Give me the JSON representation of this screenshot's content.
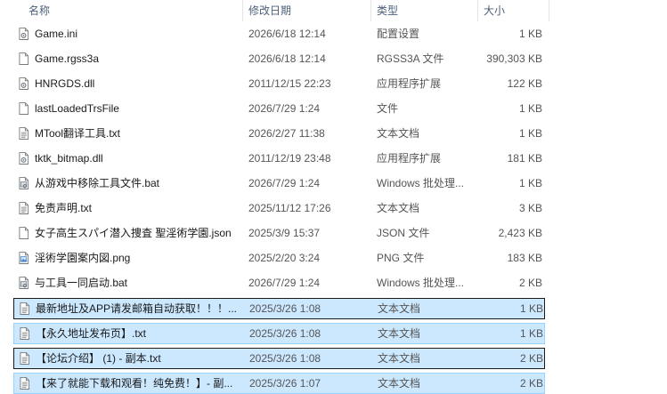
{
  "columns": {
    "name": "名称",
    "date": "修改日期",
    "type": "类型",
    "size": "大小"
  },
  "files": [
    {
      "name": "Game.ini",
      "date": "2026/6/18 12:14",
      "type": "配置设置",
      "size": "1 KB",
      "icon": "settings-file-icon"
    },
    {
      "name": "Game.rgss3a",
      "date": "2026/6/18 12:14",
      "type": "RGSS3A 文件",
      "size": "390,303 KB",
      "icon": "blank-file-icon"
    },
    {
      "name": "HNRGDS.dll",
      "date": "2011/12/15 22:23",
      "type": "应用程序扩展",
      "size": "122 KB",
      "icon": "dll-file-icon"
    },
    {
      "name": "lastLoadedTrsFile",
      "date": "2026/7/29 1:24",
      "type": "文件",
      "size": "1 KB",
      "icon": "blank-file-icon"
    },
    {
      "name": "MTool翻译工具.txt",
      "date": "2026/2/27 11:38",
      "type": "文本文档",
      "size": "1 KB",
      "icon": "text-file-icon"
    },
    {
      "name": "tktk_bitmap.dll",
      "date": "2011/12/19 23:48",
      "type": "应用程序扩展",
      "size": "181 KB",
      "icon": "dll-file-icon"
    },
    {
      "name": "从游戏中移除工具文件.bat",
      "date": "2026/7/29 1:24",
      "type": "Windows 批处理...",
      "size": "1 KB",
      "icon": "batch-file-icon"
    },
    {
      "name": "免责声明.txt",
      "date": "2025/11/12 17:26",
      "type": "文本文档",
      "size": "3 KB",
      "icon": "text-file-icon"
    },
    {
      "name": "女子高生スパイ潜入捜査 聖淫術学園.json",
      "date": "2025/3/9 15:37",
      "type": "JSON 文件",
      "size": "2,423 KB",
      "icon": "blank-file-icon"
    },
    {
      "name": "淫術学園案内図.png",
      "date": "2025/2/20 3:24",
      "type": "PNG 文件",
      "size": "183 KB",
      "icon": "image-file-icon"
    },
    {
      "name": "与工具一同启动.bat",
      "date": "2026/7/29 1:24",
      "type": "Windows 批处理...",
      "size": "2 KB",
      "icon": "batch-file-icon"
    },
    {
      "name": "最新地址及APP请发邮箱自动获取！！！...",
      "date": "2025/3/26 1:08",
      "type": "文本文档",
      "size": "1 KB",
      "icon": "text-file-icon",
      "selected": true,
      "focus": true
    },
    {
      "name": "【永久地址发布页】.txt",
      "date": "2025/3/26 1:08",
      "type": "文本文档",
      "size": "1 KB",
      "icon": "text-file-icon",
      "selected": true
    },
    {
      "name": "【论坛介绍】 (1) - 副本.txt",
      "date": "2025/3/26 1:08",
      "type": "文本文档",
      "size": "2 KB",
      "icon": "text-file-icon",
      "selected": true,
      "focus": true
    },
    {
      "name": "【来了就能下载和观看！纯免费！】- 副...",
      "date": "2025/3/26 1:07",
      "type": "文本文档",
      "size": "2 KB",
      "icon": "text-file-icon",
      "selected": true
    }
  ]
}
